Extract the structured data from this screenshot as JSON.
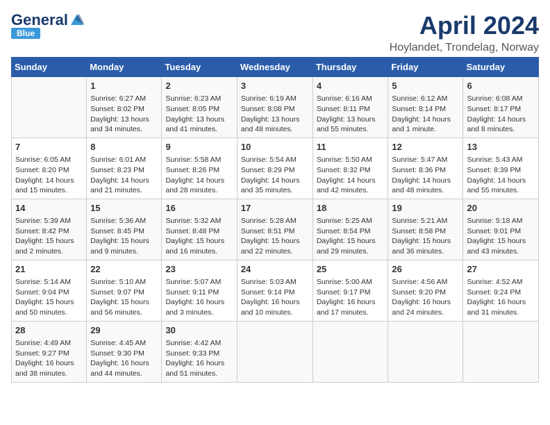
{
  "logo": {
    "general": "General",
    "blue": "Blue"
  },
  "title": "April 2024",
  "subtitle": "Hoylandet, Trondelag, Norway",
  "weekdays": [
    "Sunday",
    "Monday",
    "Tuesday",
    "Wednesday",
    "Thursday",
    "Friday",
    "Saturday"
  ],
  "weeks": [
    [
      {
        "day": "",
        "info": ""
      },
      {
        "day": "1",
        "info": "Sunrise: 6:27 AM\nSunset: 8:02 PM\nDaylight: 13 hours\nand 34 minutes."
      },
      {
        "day": "2",
        "info": "Sunrise: 6:23 AM\nSunset: 8:05 PM\nDaylight: 13 hours\nand 41 minutes."
      },
      {
        "day": "3",
        "info": "Sunrise: 6:19 AM\nSunset: 8:08 PM\nDaylight: 13 hours\nand 48 minutes."
      },
      {
        "day": "4",
        "info": "Sunrise: 6:16 AM\nSunset: 8:11 PM\nDaylight: 13 hours\nand 55 minutes."
      },
      {
        "day": "5",
        "info": "Sunrise: 6:12 AM\nSunset: 8:14 PM\nDaylight: 14 hours\nand 1 minute."
      },
      {
        "day": "6",
        "info": "Sunrise: 6:08 AM\nSunset: 8:17 PM\nDaylight: 14 hours\nand 8 minutes."
      }
    ],
    [
      {
        "day": "7",
        "info": "Sunrise: 6:05 AM\nSunset: 8:20 PM\nDaylight: 14 hours\nand 15 minutes."
      },
      {
        "day": "8",
        "info": "Sunrise: 6:01 AM\nSunset: 8:23 PM\nDaylight: 14 hours\nand 21 minutes."
      },
      {
        "day": "9",
        "info": "Sunrise: 5:58 AM\nSunset: 8:26 PM\nDaylight: 14 hours\nand 28 minutes."
      },
      {
        "day": "10",
        "info": "Sunrise: 5:54 AM\nSunset: 8:29 PM\nDaylight: 14 hours\nand 35 minutes."
      },
      {
        "day": "11",
        "info": "Sunrise: 5:50 AM\nSunset: 8:32 PM\nDaylight: 14 hours\nand 42 minutes."
      },
      {
        "day": "12",
        "info": "Sunrise: 5:47 AM\nSunset: 8:36 PM\nDaylight: 14 hours\nand 48 minutes."
      },
      {
        "day": "13",
        "info": "Sunrise: 5:43 AM\nSunset: 8:39 PM\nDaylight: 14 hours\nand 55 minutes."
      }
    ],
    [
      {
        "day": "14",
        "info": "Sunrise: 5:39 AM\nSunset: 8:42 PM\nDaylight: 15 hours\nand 2 minutes."
      },
      {
        "day": "15",
        "info": "Sunrise: 5:36 AM\nSunset: 8:45 PM\nDaylight: 15 hours\nand 9 minutes."
      },
      {
        "day": "16",
        "info": "Sunrise: 5:32 AM\nSunset: 8:48 PM\nDaylight: 15 hours\nand 16 minutes."
      },
      {
        "day": "17",
        "info": "Sunrise: 5:28 AM\nSunset: 8:51 PM\nDaylight: 15 hours\nand 22 minutes."
      },
      {
        "day": "18",
        "info": "Sunrise: 5:25 AM\nSunset: 8:54 PM\nDaylight: 15 hours\nand 29 minutes."
      },
      {
        "day": "19",
        "info": "Sunrise: 5:21 AM\nSunset: 8:58 PM\nDaylight: 15 hours\nand 36 minutes."
      },
      {
        "day": "20",
        "info": "Sunrise: 5:18 AM\nSunset: 9:01 PM\nDaylight: 15 hours\nand 43 minutes."
      }
    ],
    [
      {
        "day": "21",
        "info": "Sunrise: 5:14 AM\nSunset: 9:04 PM\nDaylight: 15 hours\nand 50 minutes."
      },
      {
        "day": "22",
        "info": "Sunrise: 5:10 AM\nSunset: 9:07 PM\nDaylight: 15 hours\nand 56 minutes."
      },
      {
        "day": "23",
        "info": "Sunrise: 5:07 AM\nSunset: 9:11 PM\nDaylight: 16 hours\nand 3 minutes."
      },
      {
        "day": "24",
        "info": "Sunrise: 5:03 AM\nSunset: 9:14 PM\nDaylight: 16 hours\nand 10 minutes."
      },
      {
        "day": "25",
        "info": "Sunrise: 5:00 AM\nSunset: 9:17 PM\nDaylight: 16 hours\nand 17 minutes."
      },
      {
        "day": "26",
        "info": "Sunrise: 4:56 AM\nSunset: 9:20 PM\nDaylight: 16 hours\nand 24 minutes."
      },
      {
        "day": "27",
        "info": "Sunrise: 4:52 AM\nSunset: 9:24 PM\nDaylight: 16 hours\nand 31 minutes."
      }
    ],
    [
      {
        "day": "28",
        "info": "Sunrise: 4:49 AM\nSunset: 9:27 PM\nDaylight: 16 hours\nand 38 minutes."
      },
      {
        "day": "29",
        "info": "Sunrise: 4:45 AM\nSunset: 9:30 PM\nDaylight: 16 hours\nand 44 minutes."
      },
      {
        "day": "30",
        "info": "Sunrise: 4:42 AM\nSunset: 9:33 PM\nDaylight: 16 hours\nand 51 minutes."
      },
      {
        "day": "",
        "info": ""
      },
      {
        "day": "",
        "info": ""
      },
      {
        "day": "",
        "info": ""
      },
      {
        "day": "",
        "info": ""
      }
    ]
  ]
}
